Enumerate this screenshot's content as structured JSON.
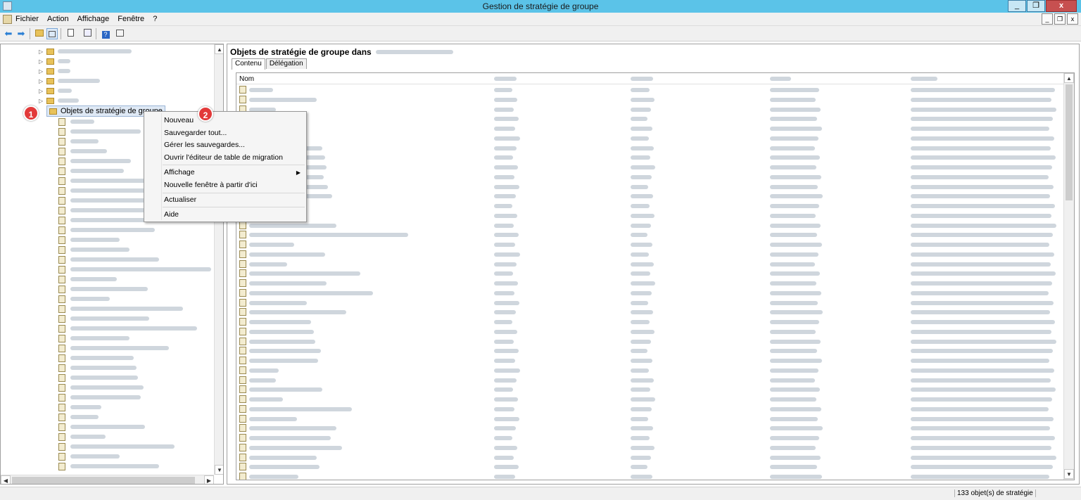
{
  "window": {
    "title": "Gestion de stratégie de groupe",
    "controls": {
      "minimize": "_",
      "restore": "❐",
      "close": "x"
    }
  },
  "menubar": {
    "items": [
      "Fichier",
      "Action",
      "Affichage",
      "Fenêtre",
      "?"
    ],
    "mdi_controls": {
      "minimize": "_",
      "restore": "❐",
      "close": "x"
    }
  },
  "toolbar": {
    "back_icon": "arrow-left-icon",
    "forward_icon": "arrow-right-icon",
    "buttons": [
      "folder-up-icon",
      "show-tree-icon",
      "properties-icon",
      "refresh-icon",
      "help-icon",
      "console-view-icon"
    ]
  },
  "tree": {
    "selected_label": "Objets de stratégie de groupe"
  },
  "right_pane": {
    "title_prefix": "Objets de stratégie de groupe dans",
    "tabs": [
      "Contenu",
      "Délégation"
    ],
    "first_column_header": "Nom"
  },
  "context_menu": {
    "items": [
      {
        "label": "Nouveau"
      },
      {
        "label": "Sauvegarder tout..."
      },
      {
        "label": "Gérer les sauvegardes..."
      },
      {
        "label": "Ouvrir l'éditeur de table de migration"
      },
      {
        "label": "Affichage",
        "submenu": true
      },
      {
        "label": "Nouvelle fenêtre à partir d'ici"
      },
      {
        "label": "Actualiser"
      },
      {
        "label": "Aide"
      }
    ]
  },
  "badges": [
    "1",
    "2"
  ],
  "status": {
    "text": "133 objet(s) de stratégie"
  }
}
